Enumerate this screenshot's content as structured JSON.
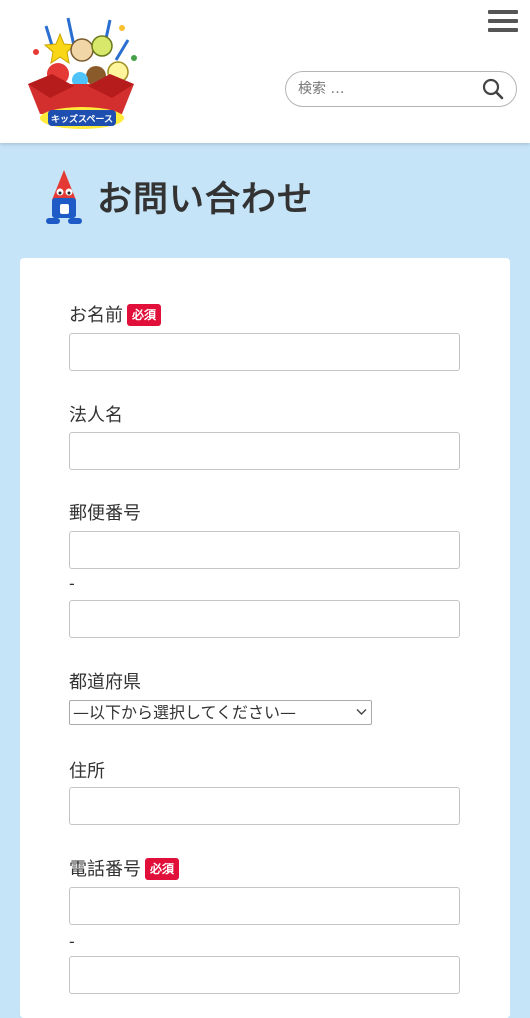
{
  "header": {
    "logo_text": "キッズスペース",
    "search": {
      "placeholder": "検索 …",
      "value": ""
    }
  },
  "page": {
    "title": "お問い合わせ"
  },
  "form": {
    "required_label": "必須",
    "hyphen": "-",
    "fields": {
      "name": {
        "label": "お名前",
        "required": true,
        "value": ""
      },
      "company": {
        "label": "法人名",
        "required": false,
        "value": ""
      },
      "postal": {
        "label": "郵便番号",
        "required": false,
        "value_first": "",
        "value_second": ""
      },
      "prefecture": {
        "label": "都道府県",
        "required": false,
        "selected": "—以下から選択してください—"
      },
      "address": {
        "label": "住所",
        "required": false,
        "value": ""
      },
      "phone": {
        "label": "電話番号",
        "required": true,
        "value_first": "",
        "value_second": ""
      }
    }
  },
  "colors": {
    "page_background": "#c5e4f8",
    "required_badge": "#e0103a",
    "header_background": "#ffffff",
    "card_background": "#ffffff"
  }
}
